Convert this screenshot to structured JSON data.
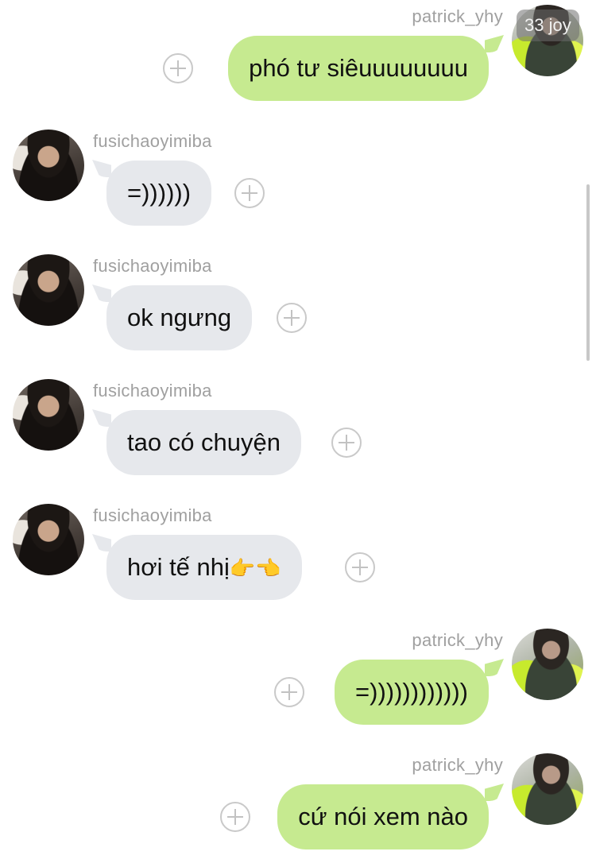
{
  "chat": {
    "badge": "33 joy",
    "messages": [
      {
        "direction": "out",
        "sender": "patrick_yhy",
        "text": "phó tư siêuuuuuuuu"
      },
      {
        "direction": "in",
        "sender": "fusichaoyimiba",
        "text": "=))))))"
      },
      {
        "direction": "in",
        "sender": "fusichaoyimiba",
        "text": "ok ngưng"
      },
      {
        "direction": "in",
        "sender": "fusichaoyimiba",
        "text": "tao có chuyện"
      },
      {
        "direction": "in",
        "sender": "fusichaoyimiba",
        "text": "hơi tế nhị",
        "emoji": "👉👈"
      },
      {
        "direction": "out",
        "sender": "patrick_yhy",
        "text": "=))))))))))))"
      },
      {
        "direction": "out",
        "sender": "patrick_yhy",
        "text": "cứ nói xem nào"
      }
    ]
  },
  "icons": {
    "add_reaction": "plus-circle-icon",
    "avatar_in": "avatar-fusichaoyimiba",
    "avatar_out": "avatar-patrick_yhy"
  },
  "colors": {
    "incoming_bubble": "#e6e8ec",
    "outgoing_bubble": "#c6ea90",
    "sender_name": "#a0a0a0",
    "plus_outline": "#c9c9c9"
  }
}
